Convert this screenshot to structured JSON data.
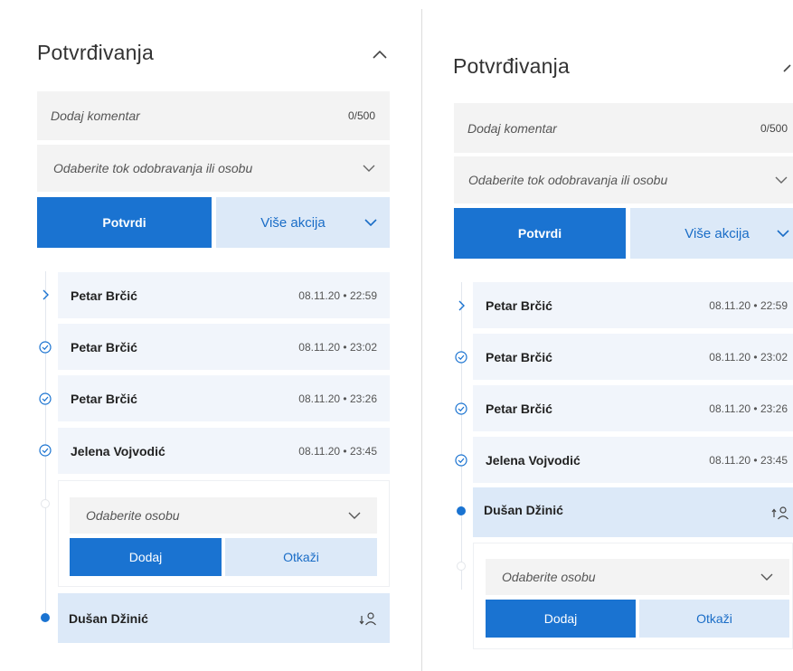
{
  "left": {
    "title": "Potvrđivanja",
    "comment_placeholder": "Dodaj komentar",
    "comment_counter": "0/500",
    "flow_placeholder": "Odaberite tok odobravanja ili osobu",
    "confirm_label": "Potvrdi",
    "more_actions_label": "Više akcija",
    "entries": [
      {
        "name": "Petar Brčić",
        "time": "08.11.20 • 22:59",
        "status": "expand"
      },
      {
        "name": "Petar Brčić",
        "time": "08.11.20 • 23:02",
        "status": "approved"
      },
      {
        "name": "Petar Brčić",
        "time": "08.11.20 • 23:26",
        "status": "approved"
      },
      {
        "name": "Jelena Vojvodić",
        "time": "08.11.20 • 23:45",
        "status": "approved"
      }
    ],
    "add_person": {
      "select_placeholder": "Odaberite osobu",
      "add_label": "Dodaj",
      "cancel_label": "Otkaži"
    },
    "current": {
      "name": "Dušan Džinić",
      "icon": "move-person-down-icon"
    }
  },
  "right": {
    "title": "Potvrđivanja",
    "comment_placeholder": "Dodaj komentar",
    "comment_counter": "0/500",
    "flow_placeholder": "Odaberite tok odobravanja ili osobu",
    "confirm_label": "Potvrdi",
    "more_actions_label": "Više akcija",
    "entries": [
      {
        "name": "Petar Brčić",
        "time": "08.11.20 • 22:59",
        "status": "expand"
      },
      {
        "name": "Petar Brčić",
        "time": "08.11.20 • 23:02",
        "status": "approved"
      },
      {
        "name": "Petar Brčić",
        "time": "08.11.20 • 23:26",
        "status": "approved"
      },
      {
        "name": "Jelena Vojvodić",
        "time": "08.11.20 • 23:45",
        "status": "approved"
      }
    ],
    "current": {
      "name": "Dušan Džinić",
      "icon": "move-person-up-icon"
    },
    "add_person": {
      "select_placeholder": "Odaberite osobu",
      "add_label": "Dodaj",
      "cancel_label": "Otkaži"
    }
  },
  "colors": {
    "primary": "#1a73d1",
    "secondary_bg": "#dce9f8",
    "row_bg": "#f1f5fb",
    "field_bg": "#f3f3f3"
  }
}
